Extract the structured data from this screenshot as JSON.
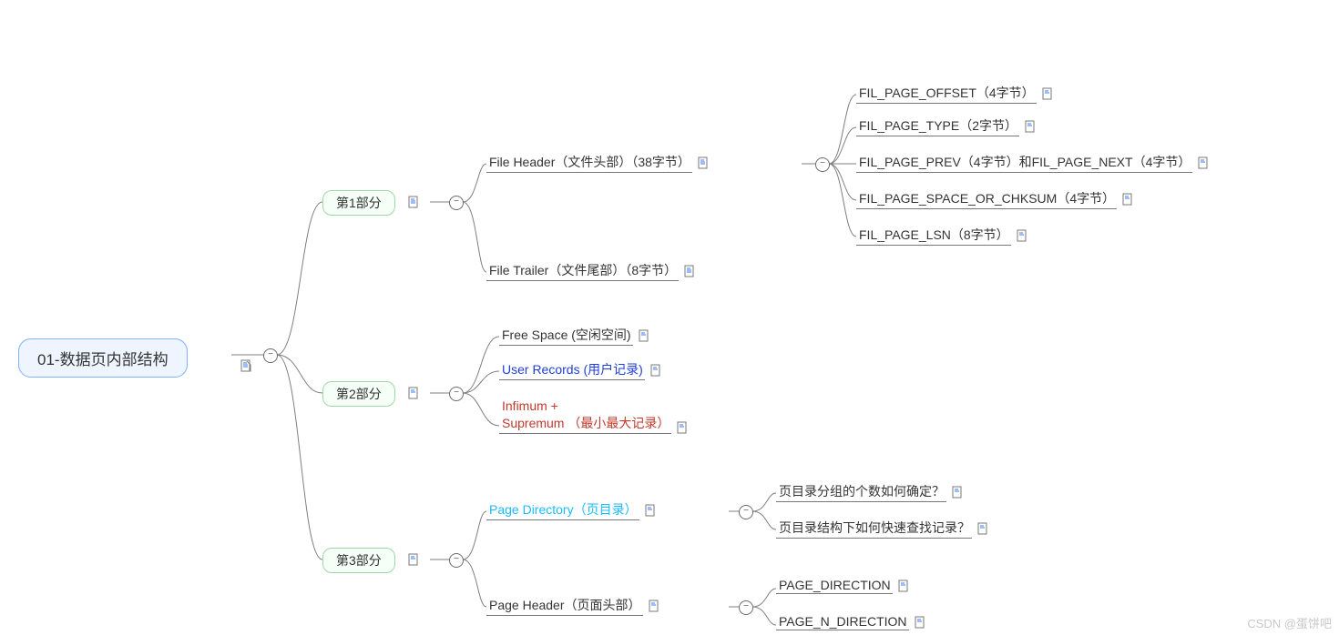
{
  "root": {
    "label": "01-数据页内部结构"
  },
  "parts": {
    "p1": "第1部分",
    "p2": "第2部分",
    "p3": "第3部分"
  },
  "p1_items": {
    "fh": "File Header（文件头部）（38字节）",
    "ft": "File Trailer（文件尾部）（8字节）",
    "fh_children": {
      "offset": "FIL_PAGE_OFFSET（4字节）",
      "type": "FIL_PAGE_TYPE（2字节）",
      "prevnext": "FIL_PAGE_PREV（4字节）和FIL_PAGE_NEXT（4字节）",
      "chksum": "FIL_PAGE_SPACE_OR_CHKSUM（4字节）",
      "lsn": "FIL_PAGE_LSN（8字节）"
    }
  },
  "p2_items": {
    "free": "Free Space (空闲空间)",
    "user": "User Records (用户记录)",
    "inf": "Infimum +\nSupremum （最小最大记录）"
  },
  "p3_items": {
    "pd": "Page Directory（页目录）",
    "ph": "Page Header（页面头部）",
    "pd_children": {
      "q1": "页目录分组的个数如何确定？",
      "q2": "页目录结构下如何快速查找记录？"
    },
    "ph_children": {
      "dir": "PAGE_DIRECTION",
      "ndir": "PAGE_N_DIRECTION"
    }
  },
  "watermark": "CSDN @蛋饼吧"
}
